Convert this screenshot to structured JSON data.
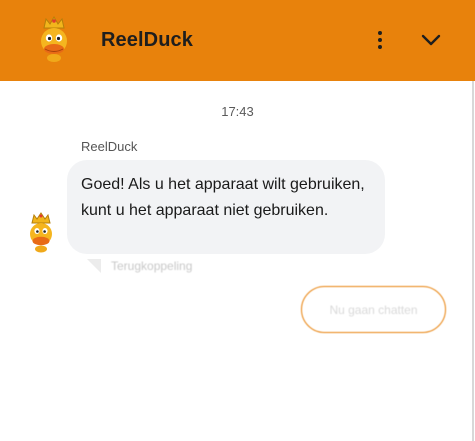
{
  "header": {
    "title": "ReelDuck",
    "accent_color": "#E8820C",
    "menu_icon": "more-vertical-icon",
    "collapse_icon": "chevron-down-icon"
  },
  "conversation": {
    "timestamp": "17:43",
    "messages": [
      {
        "sender": "ReelDuck",
        "text": "Goed! Als u het apparaat wilt gebruiken, kunt u het apparaat niet gebruiken.",
        "feedback_label": "Terugkoppeling"
      }
    ]
  },
  "quick_replies": [
    {
      "label": "Nu gaan chatten"
    }
  ]
}
